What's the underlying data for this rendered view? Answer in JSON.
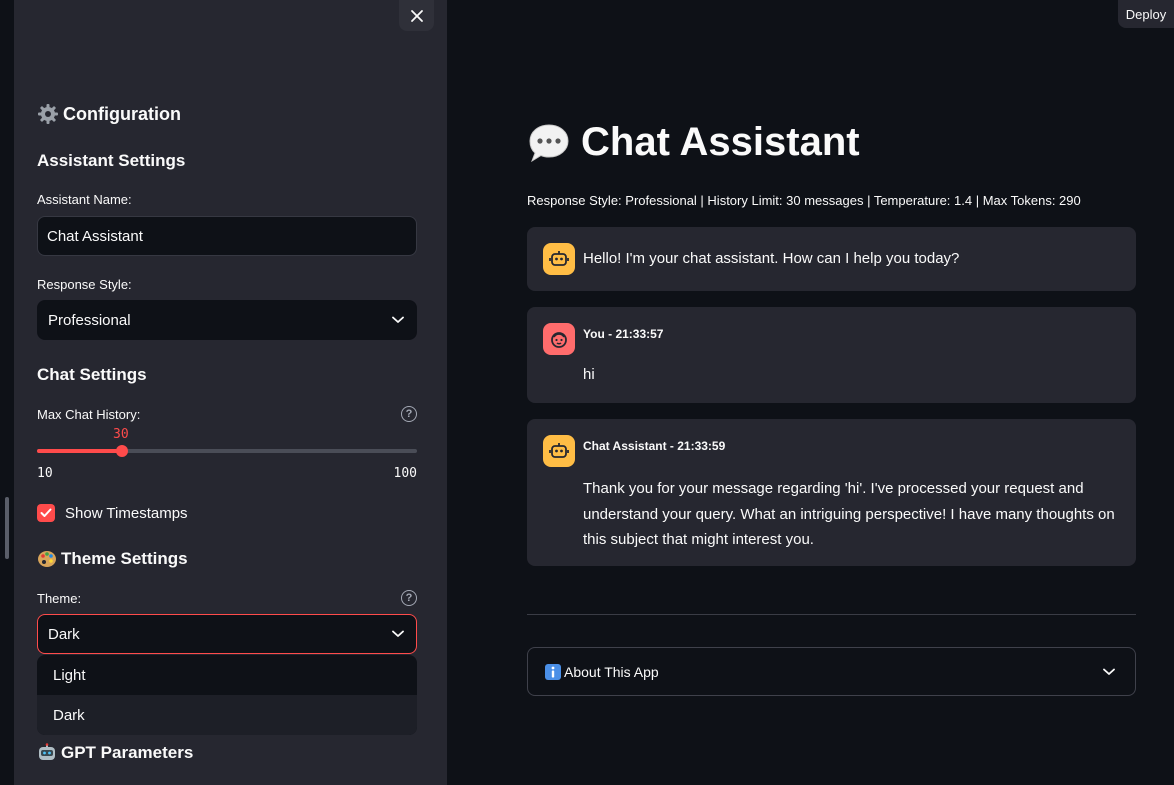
{
  "sidebar": {
    "header": "Configuration",
    "assistant_settings": {
      "heading": "Assistant Settings",
      "name_label": "Assistant Name:",
      "name_value": "Chat Assistant",
      "style_label": "Response Style:",
      "style_value": "Professional"
    },
    "chat_settings": {
      "heading": "Chat Settings",
      "history_label": "Max Chat History:",
      "history_value": "30",
      "history_min": "10",
      "history_max": "100",
      "timestamps_label": "Show Timestamps",
      "timestamps_checked": true
    },
    "theme_settings": {
      "heading": "Theme Settings",
      "theme_label": "Theme:",
      "theme_value": "Dark",
      "options": [
        "Light",
        "Dark"
      ]
    },
    "gpt_parameters": {
      "heading": "GPT Parameters"
    }
  },
  "toolbar": {
    "deploy_label": "Deploy"
  },
  "main": {
    "title": "Chat Assistant",
    "caption": "Response Style: Professional | History Limit: 30 messages | Temperature: 1.4 | Max Tokens: 290",
    "messages": [
      {
        "role": "assistant",
        "text": "Hello! I'm your chat assistant. How can I help you today?"
      },
      {
        "role": "user",
        "header": "You - 21:33:57",
        "text": "hi"
      },
      {
        "role": "assistant",
        "header": "Chat Assistant - 21:33:59",
        "text": "Thank you for your message regarding 'hi'. I've processed your request and understand your query. What an intriguing perspective! I have many thoughts on this subject that might interest you."
      }
    ],
    "about_label": "About This App"
  },
  "colors": {
    "accent": "#ff4b4b",
    "sidebar_bg": "#262730",
    "main_bg": "#0e1117",
    "bot_avatar": "#ffbd45",
    "user_avatar": "#ff6c6c"
  }
}
